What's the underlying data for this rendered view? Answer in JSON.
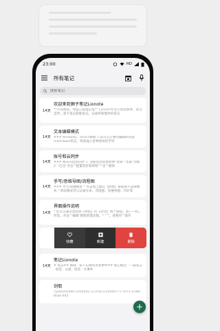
{
  "status_bar": {
    "time": "23:00",
    "icons_text": "HD"
  },
  "header": {
    "title": "所有笔记",
    "menu_icon": "menu-icon",
    "calendar_icon": "calendar-icon",
    "mic_icon": "mic-icon"
  },
  "search": {
    "placeholder": "搜索笔记"
  },
  "notes": [
    {
      "days": "14天",
      "title": "欢迎来到狮子笔记Lionote",
      "text": "**不得而知，你自己管理记笔** Lionote专注于高度整体、简洁自然，基于笔记就能笔记，记录和管理你的笔记"
    },
    {
      "days": "14天",
      "title": "文本编辑模式",
      "text": "### Windows、Stoic5模板 1.您可以方便的编辑和浏览markdown标志，快速插入各种各样的字符"
    },
    {
      "days": "14天",
      "title": "账号和云同步",
      "text": "### 账号开启后同步 1. 注册后您就会使用\"登录\"\"注册\"功能 2. \"已注\"点击\"\"配置同步和转移\"\"\"去\"\"删除"
    },
    {
      "days": "14天",
      "title": "手写/思维导图/流程图",
      "text": "### 手写/思维模式 * 点击加上面在【新建】按钮进入选择模式 * 目前模式可以记录文本、流程图、思维导图、PDF等"
    },
    {
      "days": "14天",
      "title": "界面操作说明",
      "text": "* 您可以通过左右滑【导航】的【对话】两个按钮，右一一机，然后，点击\"\"编辑\"模板管理功能。* \"\"\"。查看的\"\"操作"
    }
  ],
  "swipe_actions": {
    "favorite": "收藏",
    "new": "新建",
    "delete": "删除"
  },
  "notes_after": [
    {
      "days": "14天",
      "title": "笔记Lionote",
      "text": "# 笔记## 路线 · 私人记录和灵感事件## 核心概念 · 一篇笔记 · 标签 · 分类 · 标签 · 大事件"
    },
    {
      "days": "",
      "title": "剑取",
      "text": "![placeholder:120x442-1]{FILE}/25000777-c971-4188-8cbe-442"
    }
  ],
  "fab": {
    "label": "+"
  },
  "colors": {
    "accent": "#1e6b4d",
    "delete": "#e0443e"
  }
}
